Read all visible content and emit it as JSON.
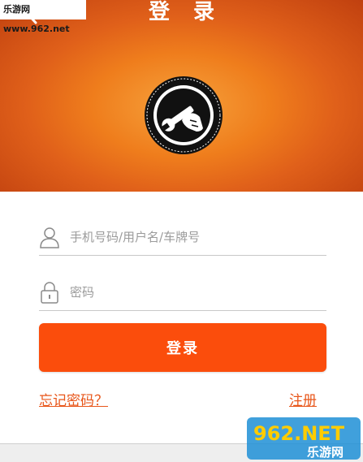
{
  "watermark_top": "乐游网 www.962.net",
  "header": {
    "title": "登 录"
  },
  "form": {
    "username_placeholder": "手机号码/用户名/车牌号",
    "password_placeholder": "密码",
    "login_label": "登录"
  },
  "links": {
    "forgot_password": "忘记密码？",
    "register": "注册"
  },
  "watermark_bottom": {
    "brand": "962.NET",
    "site": "乐游网"
  },
  "colors": {
    "header_orange": "#ef7d1c",
    "button": "#fb4d0c",
    "link": "#e8561a"
  },
  "icons": {
    "back": "chevron-left-icon",
    "logo": "wrench-hand-icon",
    "user": "user-icon",
    "lock": "lock-icon"
  }
}
